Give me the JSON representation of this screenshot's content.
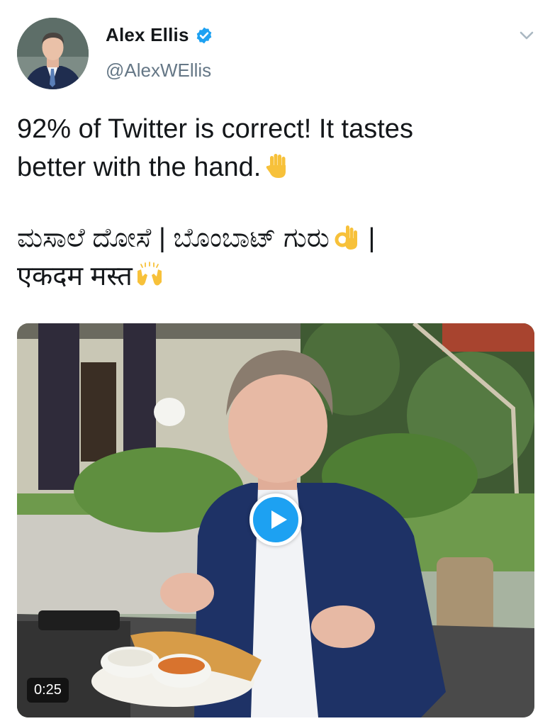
{
  "author": {
    "display_name": "Alex Ellis",
    "handle": "@AlexWEllis",
    "verified": true,
    "avatar_icon": "profile-photo"
  },
  "tweet": {
    "line1": "92% of Twitter is correct! It tastes",
    "line2": "better with the hand.",
    "line2_emoji": "raised-hand",
    "line3": "ಮಸಾಲೆ ದೋಸೆ | ಬೊಂಬಾಟ್ ಗುರು",
    "line3_emoji": "ok-hand",
    "line3_end": " |",
    "line4": "एकदम मस्त",
    "line4_emoji": "raising-hands"
  },
  "media": {
    "type": "video",
    "duration": "0:25",
    "play_icon": "play-icon"
  },
  "menu_icon": "chevron-down-icon",
  "colors": {
    "accent": "#1da1f2",
    "text": "#14171a",
    "secondary_text": "#657786"
  }
}
